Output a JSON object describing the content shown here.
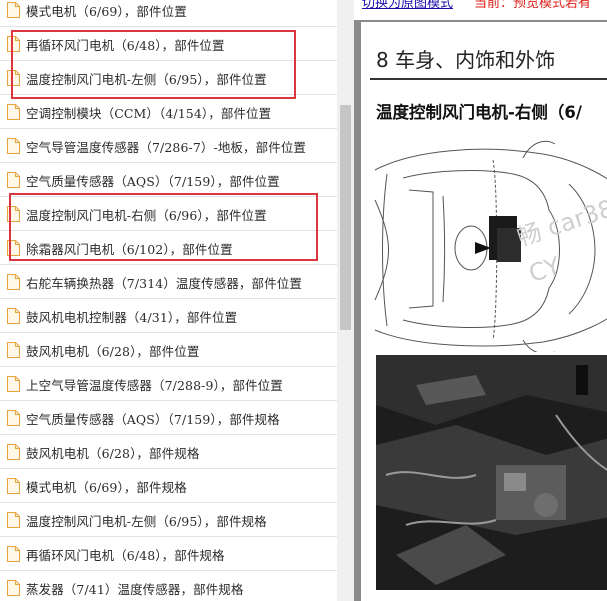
{
  "list": {
    "items": [
      {
        "label": "模式电机（6/69），部件位置"
      },
      {
        "label": "再循环风门电机（6/48），部件位置"
      },
      {
        "label": "温度控制风门电机-左侧（6/95），部件位置"
      },
      {
        "label": "空调控制模块（CCM）（4/154），部件位置"
      },
      {
        "label": "空气导管温度传感器（7/286-7）-地板，部件位置"
      },
      {
        "label": "空气质量传感器（AQS）（7/159），部件位置"
      },
      {
        "label": "温度控制风门电机-右侧（6/96），部件位置"
      },
      {
        "label": "除霜器风门电机（6/102），部件位置"
      },
      {
        "label": "右舵车辆换热器（7/314）温度传感器，部件位置"
      },
      {
        "label": "鼓风机电机控制器（4/31），部件位置"
      },
      {
        "label": "鼓风机电机（6/28），部件位置"
      },
      {
        "label": "上空气导管温度传感器（7/288-9），部件位置"
      },
      {
        "label": "空气质量传感器（AQS）（7/159），部件规格"
      },
      {
        "label": "鼓风机电机（6/28），部件规格"
      },
      {
        "label": "模式电机（6/69），部件规格"
      },
      {
        "label": "温度控制风门电机-左侧（6/95），部件规格"
      },
      {
        "label": "再循环风门电机（6/48），部件规格"
      },
      {
        "label": "蒸发器（7/41）温度传感器，部件规格"
      }
    ]
  },
  "preview": {
    "switch_link": "切换为原图模式",
    "current_mode": "当前：预览模式若有",
    "section_title": "8 车身、内饰和外饰",
    "part_title": "温度控制风门电机-右侧（6/",
    "watermark": "畅 car38 CY"
  },
  "colors": {
    "highlight": "#d9363e",
    "link": "#1a0dab",
    "mode_text": "#e0211b",
    "doc_icon": "#e8a33a"
  }
}
